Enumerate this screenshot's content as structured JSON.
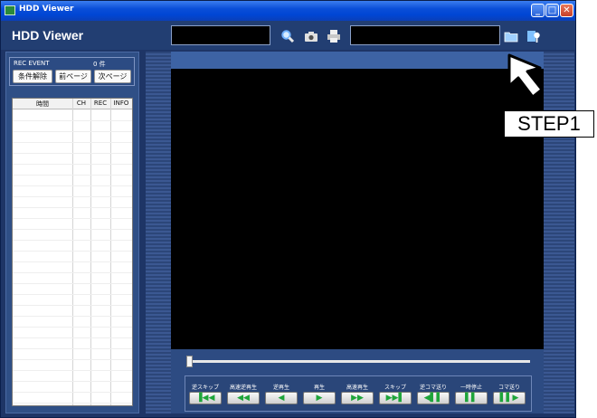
{
  "window": {
    "title": "HDD Viewer",
    "buttons": {
      "minimize": "_",
      "maximize": "□",
      "close": "✕"
    }
  },
  "header": {
    "app_title": "HDD Viewer",
    "icons": [
      "search-icon",
      "camera-icon",
      "printer-icon",
      "folder-icon",
      "settings-icon"
    ]
  },
  "event_panel": {
    "label": "REC EVENT",
    "count": "0 件",
    "buttons": {
      "clear_conditions": "条件解除",
      "prev_page": "前ページ",
      "next_page": "次ページ"
    }
  },
  "event_table": {
    "columns": [
      "時間",
      "CH",
      "REC",
      "INFO"
    ],
    "rows": []
  },
  "playback": {
    "controls": [
      {
        "label": "逆スキップ",
        "glyph": "▐◀◀",
        "icon": "skip-back-icon"
      },
      {
        "label": "高速逆再生",
        "glyph": "◀◀",
        "icon": "fast-reverse-icon"
      },
      {
        "label": "逆再生",
        "glyph": "◀",
        "icon": "reverse-icon"
      },
      {
        "label": "再生",
        "glyph": "▶",
        "icon": "play-icon"
      },
      {
        "label": "高速再生",
        "glyph": "▶▶",
        "icon": "fast-forward-icon"
      },
      {
        "label": "スキップ",
        "glyph": "▶▶▌",
        "icon": "skip-forward-icon"
      },
      {
        "label": "逆コマ送り",
        "glyph": "◀▌▌",
        "icon": "frame-back-icon"
      },
      {
        "label": "一時停止",
        "glyph": "▌▌",
        "icon": "pause-icon"
      },
      {
        "label": "コマ送り",
        "glyph": "▌▌▶",
        "icon": "frame-forward-icon"
      }
    ],
    "position": 0
  },
  "annotation": {
    "label": "STEP1"
  },
  "colors": {
    "window_bg": "#1e3566",
    "titlebar": "#0a4ed8",
    "header": "#223e72",
    "video_bg": "#000000",
    "button_glyph": "#1ea53a"
  }
}
